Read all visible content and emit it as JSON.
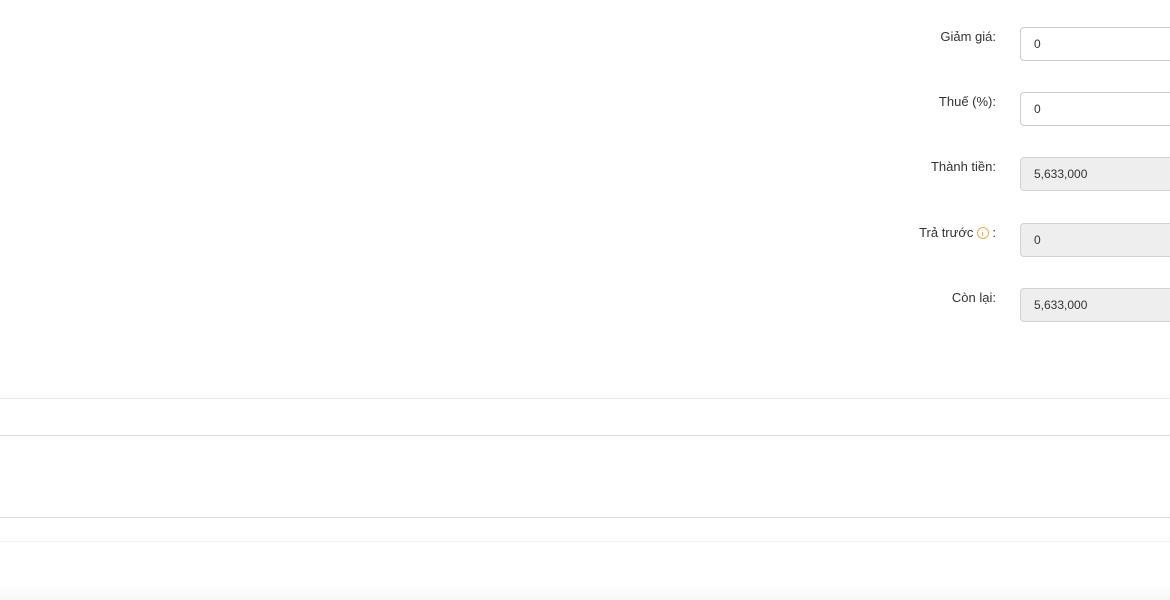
{
  "summary": {
    "discount": {
      "label": "Giảm giá:",
      "value": "0"
    },
    "tax": {
      "label": "Thuế (%):",
      "value": "0"
    },
    "total": {
      "label": "Thành tiền:",
      "value": "5,633,000"
    },
    "prepaid": {
      "label": "Trả trước",
      "suffix": ":",
      "value": "0",
      "icon": "info-icon"
    },
    "remaining": {
      "label": "Còn lại:",
      "value": "5,633,000"
    }
  },
  "colors": {
    "info_icon": "#f0ad4e",
    "readonly_bg": "#eeeeee",
    "border": "#cccccc"
  }
}
